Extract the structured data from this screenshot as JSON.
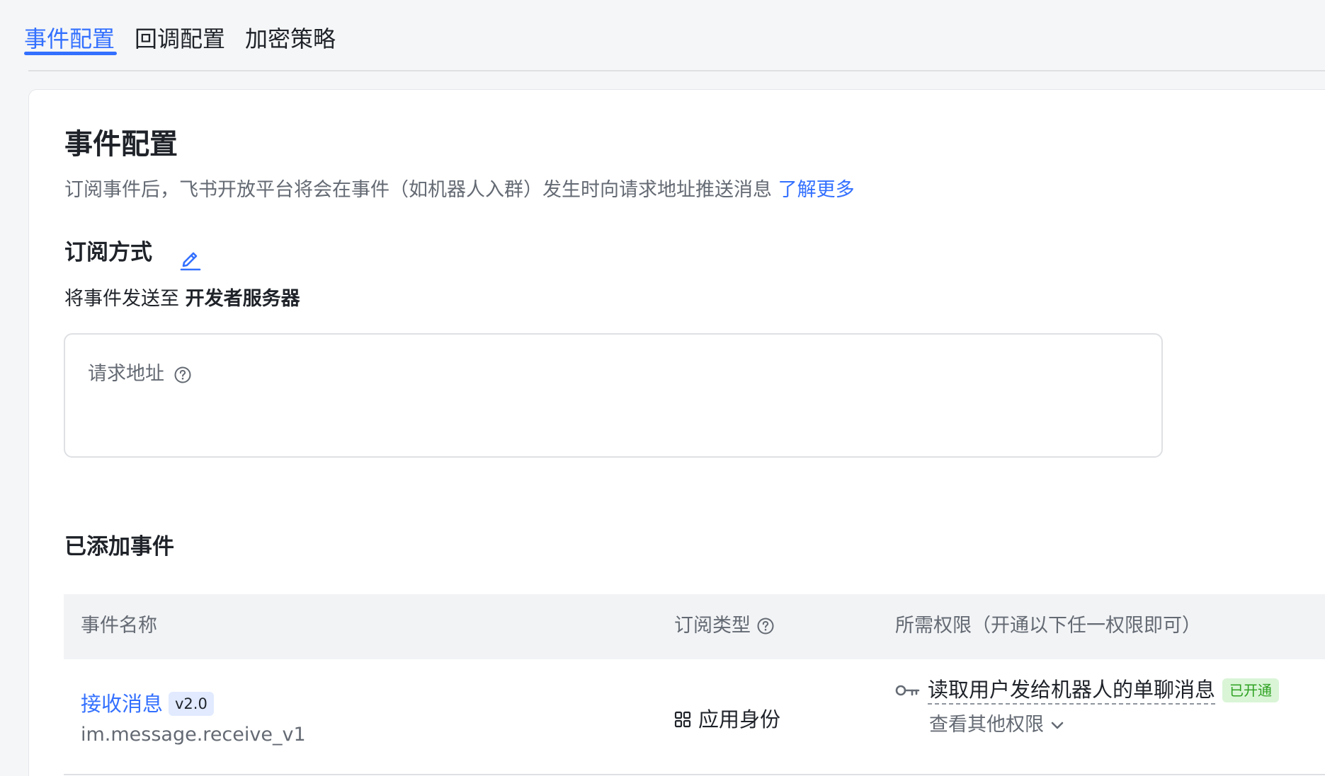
{
  "tabs": [
    {
      "label": "事件配置",
      "active": true
    },
    {
      "label": "回调配置",
      "active": false
    },
    {
      "label": "加密策略",
      "active": false
    }
  ],
  "page": {
    "title": "事件配置",
    "description": "订阅事件后，飞书开放平台将会在事件（如机器人入群）发生时向请求地址推送消息",
    "learn_more": "了解更多"
  },
  "subscription": {
    "title": "订阅方式",
    "edit_icon": "edit-icon",
    "send_prefix": "将事件发送至 ",
    "send_target": "开发者服务器",
    "url_label": "请求地址"
  },
  "events": {
    "title": "已添加事件",
    "columns": {
      "name": "事件名称",
      "type": "订阅类型",
      "permission": "所需权限（开通以下任一权限即可）"
    },
    "rows": [
      {
        "name": "接收消息",
        "version": "v2.0",
        "key": "im.message.receive_v1",
        "type": "应用身份",
        "permission": "读取用户发给机器人的单聊消息",
        "status": "已开通",
        "more": "查看其他权限"
      }
    ]
  },
  "colors": {
    "accent": "#3370ff",
    "success_text": "#2ea121",
    "success_bg": "#d9f5d6"
  }
}
